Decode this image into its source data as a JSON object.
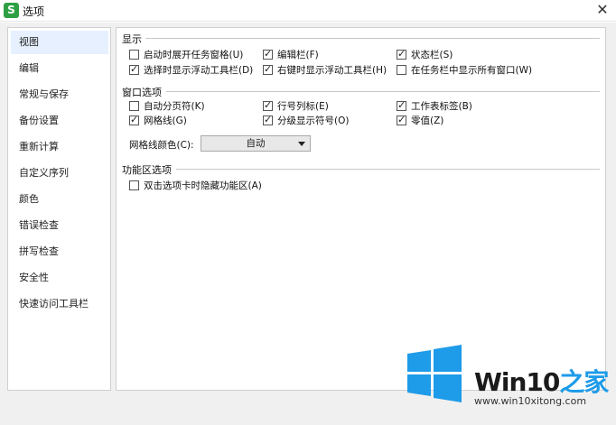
{
  "window": {
    "title": "选项",
    "app_icon": "S"
  },
  "sidebar": {
    "items": [
      {
        "label": "视图"
      },
      {
        "label": "编辑"
      },
      {
        "label": "常规与保存"
      },
      {
        "label": "备份设置"
      },
      {
        "label": "重新计算"
      },
      {
        "label": "自定义序列"
      },
      {
        "label": "颜色"
      },
      {
        "label": "错误检查"
      },
      {
        "label": "拼写检查"
      },
      {
        "label": "安全性"
      },
      {
        "label": "快速访问工具栏"
      }
    ],
    "active_index": 0
  },
  "sections": {
    "display": {
      "title": "显示",
      "options": [
        {
          "label": "启动时展开任务窗格(U)",
          "checked": false
        },
        {
          "label": "编辑栏(F)",
          "checked": true
        },
        {
          "label": "状态栏(S)",
          "checked": true
        },
        {
          "label": "选择时显示浮动工具栏(D)",
          "checked": true
        },
        {
          "label": "右键时显示浮动工具栏(H)",
          "checked": true
        },
        {
          "label": "在任务栏中显示所有窗口(W)",
          "checked": false
        }
      ]
    },
    "window_options": {
      "title": "窗口选项",
      "options": [
        {
          "label": "自动分页符(K)",
          "checked": false
        },
        {
          "label": "行号列标(E)",
          "checked": true
        },
        {
          "label": "工作表标签(B)",
          "checked": true
        },
        {
          "label": "网格线(G)",
          "checked": true
        },
        {
          "label": "分级显示符号(O)",
          "checked": true
        },
        {
          "label": "零值(Z)",
          "checked": true
        }
      ],
      "grid_color_label": "网格线颜色(C):",
      "grid_color_value": "自动"
    },
    "ribbon": {
      "title": "功能区选项",
      "options": [
        {
          "label": "双击选项卡时隐藏功能区(A)",
          "checked": false
        }
      ]
    }
  },
  "watermark": {
    "brand_main": "Win10",
    "brand_accent": "之家",
    "url": "www.win10xitong.com"
  },
  "colors": {
    "active_item_bg": "#e6f0ff",
    "logo_blue": "#1e9be9",
    "app_icon_green": "#2ea043"
  }
}
